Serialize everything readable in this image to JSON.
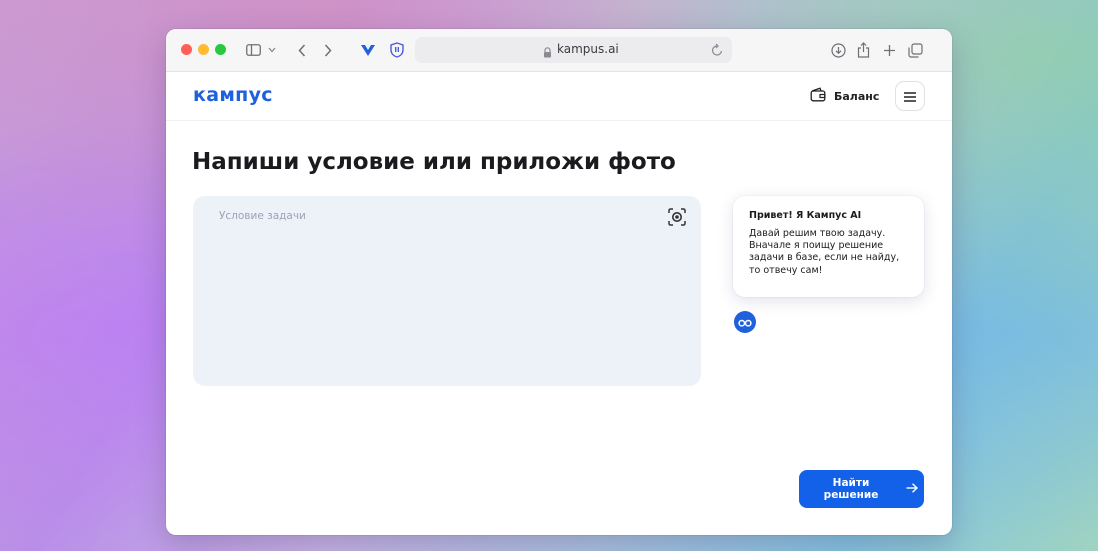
{
  "browser": {
    "url": "kampus.ai",
    "icons": [
      "close-dot",
      "minimize-dot",
      "zoom-dot",
      "sidebar-icon",
      "chevron-down-icon",
      "back-icon",
      "forward-icon",
      "extension-icon",
      "shield-icon",
      "lock-icon",
      "reload-icon",
      "download-icon",
      "share-icon",
      "plus-icon",
      "tabs-icon"
    ]
  },
  "header": {
    "logo": "кампус",
    "balance_label": "Баланс"
  },
  "main": {
    "title": "Напиши условие или приложи фото",
    "task_placeholder": "Условие задачи"
  },
  "assistant": {
    "title": "Привет! Я Кампус AI",
    "message": "Давай решим твою задачу. Вначале я поищу решение задачи в базе, если не найду, то отвечу сам!"
  },
  "actions": {
    "submit_label": "Найти решение"
  },
  "colors": {
    "brand": "#1f60dd",
    "button": "#1361e8",
    "input_bg": "#edf1f8"
  }
}
